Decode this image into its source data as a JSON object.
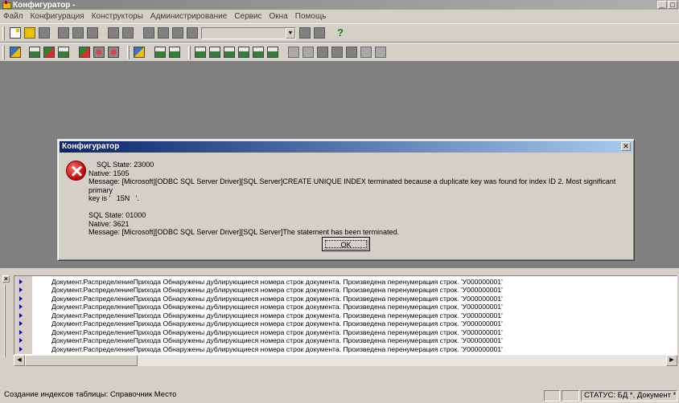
{
  "window": {
    "title": "Конфигуратор -",
    "icon": "configurator-app-icon",
    "controls": [
      "_",
      "□"
    ]
  },
  "menu": {
    "items": [
      "Файл",
      "Конфигурация",
      "Конструкторы",
      "Администрирование",
      "Сервис",
      "Окна",
      "Помощь"
    ]
  },
  "toolbar": {
    "help_label": "?",
    "combo_value": "",
    "combo_arrow": "▼"
  },
  "dialog": {
    "title": "Конфигуратор",
    "close": "✕",
    "icon": "error-icon",
    "lines": [
      "    SQL State: 23000",
      "Native: 1505",
      "Message: [Microsoft][ODBC SQL Server Driver][SQL Server]CREATE UNIQUE INDEX terminated because a duplicate key was found for index ID 2. Most significant primary",
      "key is '   15N   '.",
      "",
      "SQL State: 01000",
      "Native: 3621",
      "Message: [Microsoft][ODBC SQL Server Driver][SQL Server]The statement has been terminated."
    ],
    "ok_label": "OK"
  },
  "messages": {
    "close": "×",
    "rows": [
      "Документ.РаспределениеПрихода Обнаружены дублирующиеся номера строк документа. Произведена перенумерация строк. 'У000000001'",
      "Документ.РаспределениеПрихода Обнаружены дублирующиеся номера строк документа. Произведена перенумерация строк. 'У000000001'",
      "Документ.РаспределениеПрихода Обнаружены дублирующиеся номера строк документа. Произведена перенумерация строк. 'У000000001'",
      "Документ.РаспределениеПрихода Обнаружены дублирующиеся номера строк документа. Произведена перенумерация строк. 'У000000001'",
      "Документ.РаспределениеПрихода Обнаружены дублирующиеся номера строк документа. Произведена перенумерация строк. 'У000000001'",
      "Документ.РаспределениеПрихода Обнаружены дублирующиеся номера строк документа. Произведена перенумерация строк. 'У000000001'",
      "Документ.РаспределениеПрихода Обнаружены дублирующиеся номера строк документа. Произведена перенумерация строк. 'У000000001'",
      "Документ.РаспределениеПрихода Обнаружены дублирующиеся номера строк документа. Произведена перенумерация строк. 'У000000001'",
      "Документ.РаспределениеПрихода Обнаружены дублирующиеся номера строк документа. Произведена перенумерация строк. 'У000000001'"
    ],
    "scroll_left": "◀",
    "scroll_right": "▶"
  },
  "status": {
    "main_text": "Создание индексов таблицы: Справочник Место",
    "pane1": "",
    "pane2": "",
    "status_text": "СТАТУС: БД *, Документ *"
  }
}
